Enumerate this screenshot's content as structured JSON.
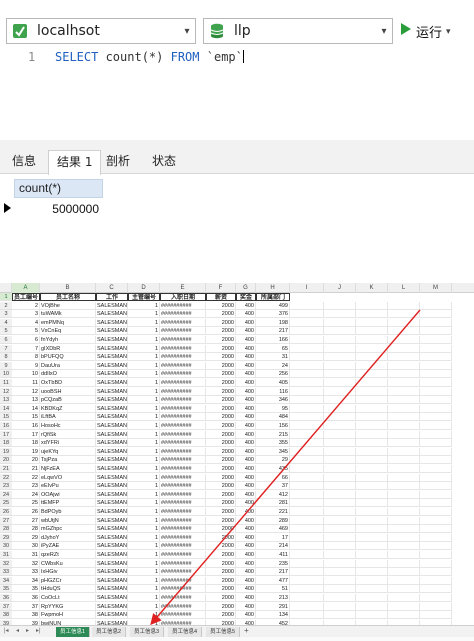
{
  "toolbar": {
    "connection": "localhsot",
    "database": "llp",
    "run_label": "运行",
    "chevron": "▾"
  },
  "editor": {
    "line_number": "1",
    "sql_select": "SELECT",
    "sql_count": " count(*) ",
    "sql_from": "FROM",
    "sql_table": " `emp`"
  },
  "result_tabs": [
    "信息",
    "结果 1",
    "剖析",
    "状态"
  ],
  "result": {
    "column": "count(*)",
    "value": "5000000"
  },
  "sheet": {
    "columns": [
      "A",
      "B",
      "C",
      "D",
      "E",
      "F",
      "G",
      "H",
      "I",
      "J",
      "K",
      "L",
      "M"
    ],
    "header": [
      "员工编号",
      "员工名称",
      "工作",
      "主管编号",
      "入职日期",
      "薪资",
      "奖金",
      "所属部门"
    ],
    "rows": [
      {
        "n": "2",
        "id": "2",
        "name": "VOjBhe",
        "dept": "499"
      },
      {
        "n": "3",
        "id": "3",
        "name": "tuWAMk",
        "dept": "376"
      },
      {
        "n": "4",
        "id": "4",
        "name": "emPMNq",
        "dept": "198"
      },
      {
        "n": "5",
        "id": "5",
        "name": "VxCnEq",
        "dept": "217"
      },
      {
        "n": "6",
        "id": "6",
        "name": "fnYdyh",
        "dept": "166"
      },
      {
        "n": "7",
        "id": "7",
        "name": "gIXDbR",
        "dept": "65"
      },
      {
        "n": "8",
        "id": "8",
        "name": "bPUFQQ",
        "dept": "31"
      },
      {
        "n": "9",
        "id": "9",
        "name": "DauUra",
        "dept": "24"
      },
      {
        "n": "10",
        "id": "10",
        "name": "ddIlxO",
        "dept": "256"
      },
      {
        "n": "11",
        "id": "11",
        "name": "OxTbBD",
        "dept": "405"
      },
      {
        "n": "12",
        "id": "12",
        "name": "uooBSH",
        "dept": "116"
      },
      {
        "n": "13",
        "id": "13",
        "name": "pCQzaB",
        "dept": "346"
      },
      {
        "n": "14",
        "id": "14",
        "name": "KBDKqZ",
        "dept": "95"
      },
      {
        "n": "15",
        "id": "15",
        "name": "iLftBA",
        "dept": "484"
      },
      {
        "n": "16",
        "id": "16",
        "name": "HosoHc",
        "dept": "156"
      },
      {
        "n": "17",
        "id": "17",
        "name": "rQfiSk",
        "dept": "215"
      },
      {
        "n": "18",
        "id": "18",
        "name": "xdYFRi",
        "dept": "355"
      },
      {
        "n": "19",
        "id": "19",
        "name": "ujeKYq",
        "dept": "345"
      },
      {
        "n": "20",
        "id": "20",
        "name": "TsjPza",
        "dept": "29"
      },
      {
        "n": "21",
        "id": "21",
        "name": "NjFzEA",
        "dept": "435"
      },
      {
        "n": "22",
        "id": "22",
        "name": "eLqwVO",
        "dept": "66"
      },
      {
        "n": "23",
        "id": "23",
        "name": "eEIvPu",
        "dept": "37"
      },
      {
        "n": "24",
        "id": "24",
        "name": "OOAjwi",
        "dept": "412"
      },
      {
        "n": "25",
        "id": "25",
        "name": "ttEMFP",
        "dept": "281"
      },
      {
        "n": "26",
        "id": "26",
        "name": "BdPOyb",
        "dept": "221"
      },
      {
        "n": "27",
        "id": "27",
        "name": "wbUtjN",
        "dept": "289"
      },
      {
        "n": "28",
        "id": "28",
        "name": "mGZhpc",
        "dept": "469"
      },
      {
        "n": "29",
        "id": "29",
        "name": "dJyhoY",
        "dept": "17"
      },
      {
        "n": "30",
        "id": "30",
        "name": "iPyZAE",
        "dept": "214"
      },
      {
        "n": "31",
        "id": "31",
        "name": "qzeRZt",
        "dept": "411"
      },
      {
        "n": "32",
        "id": "32",
        "name": "CWbsKu",
        "dept": "235"
      },
      {
        "n": "33",
        "id": "33",
        "name": "IxHGiv",
        "dept": "217"
      },
      {
        "n": "34",
        "id": "34",
        "name": "pHGZCr",
        "dept": "477"
      },
      {
        "n": "35",
        "id": "35",
        "name": "tHduQS",
        "dept": "51"
      },
      {
        "n": "36",
        "id": "36",
        "name": "CoOcLt",
        "dept": "213"
      },
      {
        "n": "37",
        "id": "37",
        "name": "RpYYKG",
        "dept": "291"
      },
      {
        "n": "38",
        "id": "38",
        "name": "FwpmoH",
        "dept": "134"
      },
      {
        "n": "39",
        "id": "39",
        "name": "bwjNUN",
        "dept": "452"
      }
    ],
    "job": "SALESMAN",
    "mgr": "1",
    "hiredate": "##########",
    "sal": "2000",
    "comm": "400",
    "tabs": [
      "员工信息1",
      "员工信息2",
      "员工信息3",
      "员工信息4",
      "员工信息5"
    ],
    "add_tab": "+"
  },
  "colors": {
    "arrow": "#e02020",
    "run": "#2a9d3a",
    "accent": "#2e8b57"
  }
}
